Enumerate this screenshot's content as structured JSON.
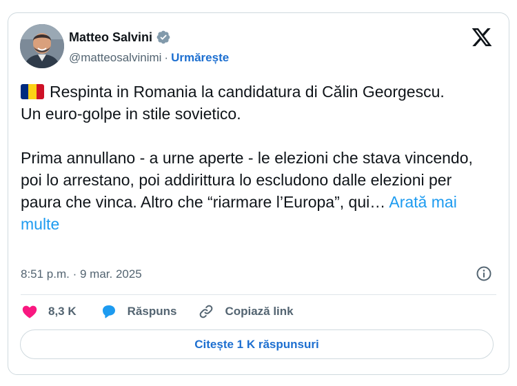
{
  "author": {
    "display_name": "Matteo Salvini",
    "handle": "@matteosalvinimi",
    "separator": "·",
    "follow_label": "Urmărește"
  },
  "flag": {
    "colors": [
      "#002b7f",
      "#fcd116",
      "#ce1126"
    ]
  },
  "post": {
    "line1": "Respinta in Romania la candidatura di Călin Georgescu.",
    "line2": "Un euro-golpe in stile sovietico.",
    "paragraph2": "Prima annullano - a urne aperte - le elezioni che stava vincendo, poi lo arrestano, poi addirittura lo escludono dalle elezioni per paura che vinca. Altro che “riarmare l’Europa”, qui…",
    "show_more_label": "Arată mai multe"
  },
  "timestamp": "8:51 p.m. · 9 mar. 2025",
  "actions": {
    "like_count": "8,3 K",
    "reply_label": "Răspuns",
    "copy_link_label": "Copiază link"
  },
  "replies_button_label": "Citește 1 K răspunsuri",
  "colors": {
    "like": "#f91880",
    "reply": "#1d9bf0",
    "link": "#1d6fd0",
    "verified": "#829aab"
  }
}
